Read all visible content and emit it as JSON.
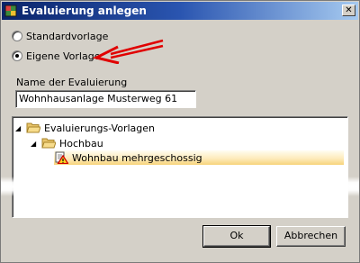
{
  "window": {
    "title": "Evaluierung anlegen",
    "close_glyph": "✕"
  },
  "options": {
    "standard_label": "Standardvorlage",
    "custom_label": "Eigene Vorlage",
    "selected": "custom"
  },
  "name_field": {
    "label": "Name der Evaluierung",
    "value": "Wohnhausanlage Musterweg 61"
  },
  "tree": {
    "items": [
      {
        "label": "Evaluierungs-Vorlagen",
        "icon": "open-folder-icon",
        "expanded": true
      },
      {
        "label": "Hochbau",
        "icon": "open-folder-icon",
        "expanded": true
      },
      {
        "label": "Wohnbau mehrgeschossig",
        "icon": "warning-document-icon",
        "selected": true
      }
    ]
  },
  "buttons": {
    "ok_label": "Ok",
    "cancel_label": "Abbrechen"
  },
  "annotation": {
    "arrow_color": "#e00000",
    "points_to": "custom option"
  }
}
